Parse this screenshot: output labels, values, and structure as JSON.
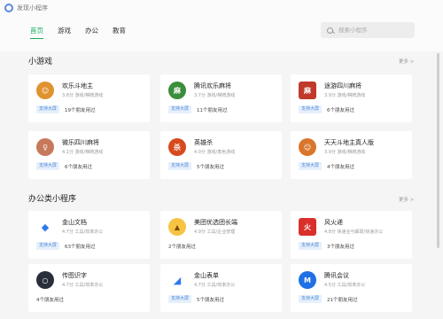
{
  "window": {
    "title": "发现小程序"
  },
  "tabs": [
    {
      "label": "首页",
      "active": true
    },
    {
      "label": "游戏"
    },
    {
      "label": "办公"
    },
    {
      "label": "教育"
    }
  ],
  "search": {
    "placeholder": "搜索小程序"
  },
  "sections": [
    {
      "title": "小游戏",
      "more": "更多 >",
      "cards": [
        {
          "name": "欢乐斗地主",
          "rating": "3.8分",
          "category": "游戏/棋牌游戏",
          "badge": "支持大屏",
          "users": "19个朋友用过",
          "icon": "face-icon",
          "color": "#e0922f"
        },
        {
          "name": "腾讯欢乐麻将",
          "rating": "3.7分",
          "category": "游戏/棋牌游戏",
          "badge": "支持大屏",
          "users": "11个朋友用过",
          "icon": "mahjong-icon",
          "color": "#3b8e3c"
        },
        {
          "name": "途游四川麻将",
          "rating": "3.9分",
          "category": "游戏/棋牌游戏",
          "badge": "支持大屏",
          "users": "6个朋友用过",
          "icon": "mahjong-icon",
          "color": "#c0392b"
        },
        {
          "name": "微乐四川麻将",
          "rating": "4.1分",
          "category": "游戏/棋牌游戏",
          "badge": "支持大屏",
          "users": "6个朋友用过",
          "icon": "girl-icon",
          "color": "#c77a5a"
        },
        {
          "name": "英雄杀",
          "rating": "4.0分",
          "category": "游戏/角色游戏",
          "badge": "支持大屏",
          "users": "5个朋友用过",
          "icon": "hero-icon",
          "color": "#d64a1d"
        },
        {
          "name": "天天斗地主真人版",
          "rating": "3.9分",
          "category": "游戏/棋牌游戏",
          "badge": "支持大屏",
          "users": "4个朋友用过",
          "icon": "face-icon",
          "color": "#d9762b"
        }
      ]
    },
    {
      "title": "办公类小程序",
      "more": "更多 >",
      "cards": [
        {
          "name": "金山文档",
          "rating": "4.7分",
          "category": "工具/效率办公",
          "badge": "支持大屏",
          "users": "63个朋友用过",
          "icon": "document-icon",
          "color": "#2d7be8"
        },
        {
          "name": "美团优选团长端",
          "rating": "4.9分",
          "category": "工具/企业管理",
          "badge": "",
          "users": "2个朋友用过",
          "icon": "mascot-icon",
          "color": "#f6c343"
        },
        {
          "name": "风火递",
          "rating": "4.8分",
          "category": "快递业与邮政/快递办公",
          "badge": "支持大屏",
          "users": "3个朋友用过",
          "icon": "fire-icon",
          "color": "#d9302c"
        },
        {
          "name": "传图识字",
          "rating": "4.7分",
          "category": "工具/效率办公",
          "badge": "",
          "users": "4个朋友用过",
          "icon": "scan-icon",
          "color": "#2a2e3a"
        },
        {
          "name": "金山表单",
          "rating": "4.7分",
          "category": "工具/效率办公",
          "badge": "支持大屏",
          "users": "5个朋友用过",
          "icon": "form-icon",
          "color": "#2d7be8"
        },
        {
          "name": "腾讯会议",
          "rating": "4.5分",
          "category": "工具/效率办公",
          "badge": "支持大屏",
          "users": "21个朋友用过",
          "icon": "meeting-icon",
          "color": "#1f6fe5"
        }
      ]
    }
  ]
}
